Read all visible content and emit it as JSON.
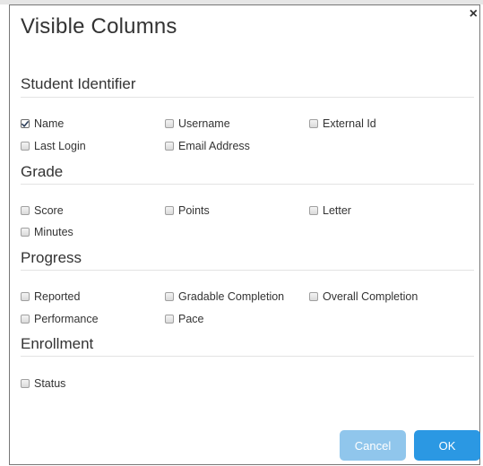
{
  "dialog": {
    "title": "Visible Columns",
    "close_glyph": "×"
  },
  "sections": {
    "student_identifier": {
      "header": "Student Identifier",
      "options": {
        "name": {
          "label": "Name",
          "checked": true
        },
        "username": {
          "label": "Username",
          "checked": false
        },
        "external_id": {
          "label": "External Id",
          "checked": false
        },
        "last_login": {
          "label": "Last Login",
          "checked": false
        },
        "email_address": {
          "label": "Email Address",
          "checked": false
        }
      }
    },
    "grade": {
      "header": "Grade",
      "options": {
        "score": {
          "label": "Score",
          "checked": false
        },
        "points": {
          "label": "Points",
          "checked": false
        },
        "letter": {
          "label": "Letter",
          "checked": false
        },
        "minutes": {
          "label": "Minutes",
          "checked": false
        }
      }
    },
    "progress": {
      "header": "Progress",
      "options": {
        "reported": {
          "label": "Reported",
          "checked": false
        },
        "gradable_completion": {
          "label": "Gradable Completion",
          "checked": false
        },
        "overall_completion": {
          "label": "Overall Completion",
          "checked": false
        },
        "performance": {
          "label": "Performance",
          "checked": false
        },
        "pace": {
          "label": "Pace",
          "checked": false
        }
      }
    },
    "enrollment": {
      "header": "Enrollment",
      "options": {
        "status": {
          "label": "Status",
          "checked": false
        }
      }
    }
  },
  "buttons": {
    "cancel_label": "Cancel",
    "ok_label": "OK"
  },
  "colors": {
    "ok_button": "#2b98e3",
    "cancel_button": "#90c6ec",
    "text": "#333333"
  }
}
